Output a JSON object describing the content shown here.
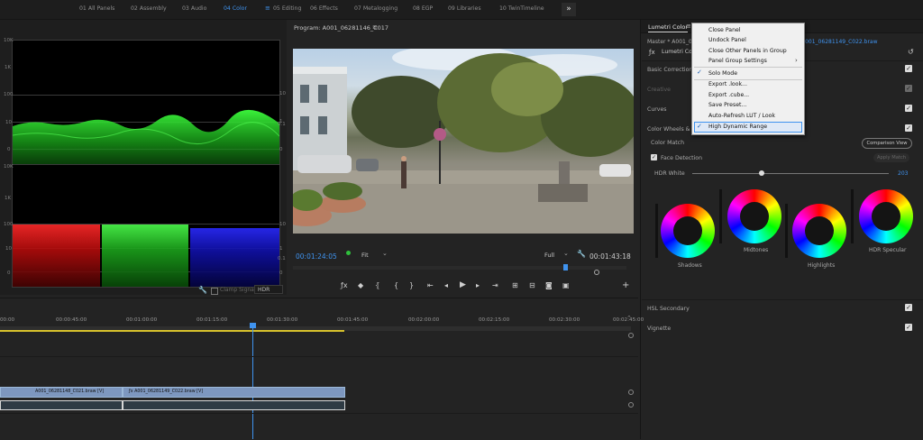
{
  "workspace": {
    "tabs": [
      "01 All Panels",
      "02 Assembly",
      "03 Audio",
      "04 Color",
      "05 Editing",
      "06 Effects",
      "07 Metalogging",
      "08 EGP",
      "09 Libraries",
      "10 TwinTimeline"
    ],
    "active_tab": "04 Color",
    "more_label": "»"
  },
  "scopes": {
    "top_left_labels": [
      "10K",
      "1K",
      "100",
      "10",
      "0"
    ],
    "top_right_labels": [
      "10",
      "1",
      "0.1",
      "0"
    ],
    "bottom_left_labels": [
      "10K",
      "1K",
      "100",
      "10",
      "0"
    ],
    "bottom_right_labels": [
      "10",
      "1",
      "0.1",
      "0"
    ],
    "clamp_label": "Clamp Signal",
    "mode_value": "HDR"
  },
  "program": {
    "title": "Program: A001_06281146_C017",
    "timecode": "00:01:24:05",
    "fit_value": "Fit",
    "quality_value": "Full",
    "duration": "00:01:43:18"
  },
  "lumetri": {
    "panel_title": "Lumetri Color",
    "master_label": "Master * A001_062",
    "clip_link": "A001_06281149_C022.braw",
    "fx_label": "Lumetri Colo",
    "basic_correction": "Basic Correction",
    "creative": "Creative",
    "curves": "Curves",
    "color_wheels": "Color Wheels & Ma",
    "color_match": "Color Match",
    "comparison_view": "Comparison View",
    "face_detection": "Face Detection",
    "apply_match": "Apply Match",
    "hdr_white_label": "HDR White",
    "hdr_white_value": "203",
    "wheels": [
      "Shadows",
      "Midtones",
      "Highlights",
      "HDR Specular"
    ],
    "hsl_secondary": "HSL Secondary",
    "vignette": "Vignette"
  },
  "context_menu": {
    "items": [
      {
        "label": "Close Panel",
        "checked": false
      },
      {
        "label": "Undock Panel",
        "checked": false
      },
      {
        "label": "Close Other Panels in Group",
        "checked": false
      },
      {
        "label": "Panel Group Settings",
        "checked": false,
        "submenu": true
      },
      {
        "label": "Solo Mode",
        "checked": true
      },
      {
        "label": "Export .look...",
        "checked": false
      },
      {
        "label": "Export .cube...",
        "checked": false
      },
      {
        "label": "Save Preset...",
        "checked": false
      },
      {
        "label": "Auto-Refresh LUT / Look",
        "checked": false
      },
      {
        "label": "High Dynamic Range",
        "checked": true
      }
    ]
  },
  "timeline": {
    "ruler": [
      "00:00",
      "00:00:45:00",
      "00:01:00:00",
      "00:01:15:00",
      "00:01:30:00",
      "00:01:45:00",
      "00:02:00:00",
      "00:02:15:00",
      "00:02:30:00",
      "00:02:45:00"
    ],
    "clip1_name": "A001_06281148_C021.braw [V]",
    "clip2_name": "A001_06281149_C022.braw [V]"
  }
}
